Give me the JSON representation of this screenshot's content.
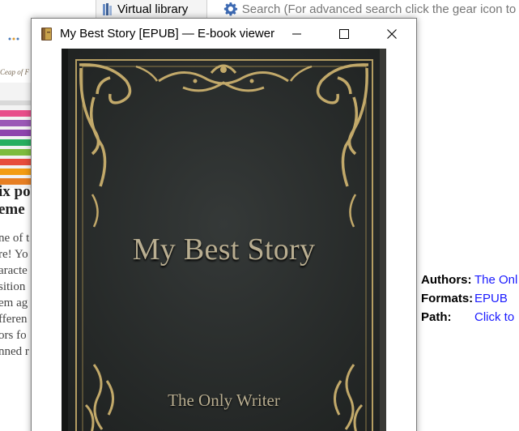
{
  "background": {
    "virtual_library_label": "Virtual library",
    "search_placeholder": "Search (For advanced search click the gear icon to t",
    "left_page": {
      "logo_text": "Ceap of F",
      "heading_lines": [
        "ix po",
        "eme"
      ],
      "body_lines": [
        "ne of t",
        "re! Yo",
        "aracte",
        "sition",
        "em ag",
        "fferen",
        "ors fo",
        "nned r"
      ]
    },
    "metadata": [
      {
        "key": "Authors:",
        "value": "The Onl"
      },
      {
        "key": "Formats:",
        "value": "EPUB"
      },
      {
        "key": "Path:",
        "value": "Click to"
      }
    ]
  },
  "viewer": {
    "window_title": "My Best Story [EPUB] — E-book viewer",
    "icons": {
      "app": "book-icon",
      "minimize": "minimize-icon",
      "maximize": "maximize-icon",
      "close": "close-icon"
    },
    "cover": {
      "title": "My Best Story",
      "author": "The Only Writer",
      "colors": {
        "leather": "#2a2d2c",
        "gold": "#b49d62",
        "text": "#b9ae91"
      }
    }
  }
}
